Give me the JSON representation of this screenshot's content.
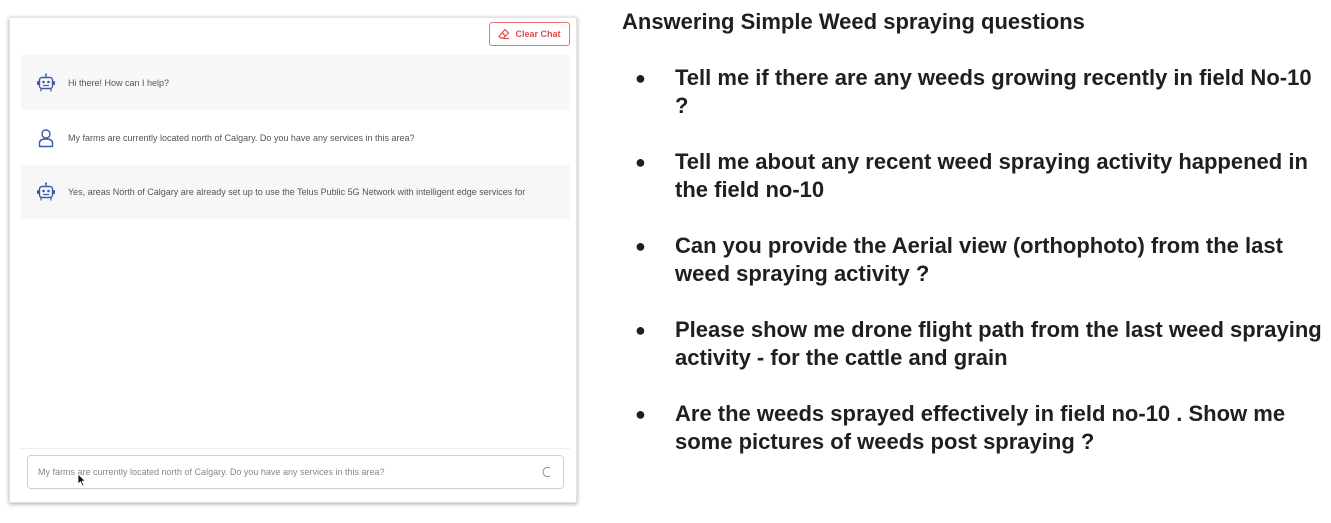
{
  "chat": {
    "clear_button_label": "Clear Chat",
    "messages": [
      {
        "role": "bot",
        "text": "Hi there! How can I help?"
      },
      {
        "role": "user",
        "text": "My farms are currently located north of Calgary. Do you have any services in this area?"
      },
      {
        "role": "bot",
        "text": "Yes, areas North of Calgary are already set up to use the Telus Public 5G Network with intelligent edge services for"
      }
    ],
    "input_value": "My farms are currently located north of Calgary. Do you have any services in this area?",
    "colors": {
      "accent_red": "#e04a4a",
      "avatar_blue": "#3d5aa8"
    }
  },
  "questions": {
    "title": "Answering Simple Weed spraying questions",
    "items": [
      "Tell me if there are any weeds growing recently  in field No-10 ?",
      "Tell me about any recent weed spraying activity happened in the field no-10",
      "Can you provide the Aerial view (orthophoto) from the last weed spraying activity ?",
      "Please show me drone flight path from the last weed spraying activity - for the cattle and  grain",
      "Are the weeds  sprayed effectively in field no-10 . Show me some pictures of weeds post spraying ?"
    ],
    "bullet": "●"
  }
}
